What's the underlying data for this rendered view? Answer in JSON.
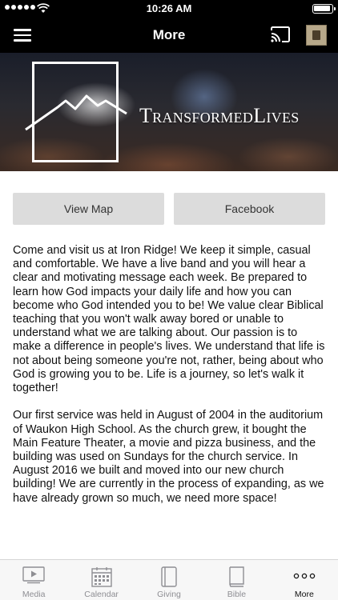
{
  "status_bar": {
    "time": "10:26 AM"
  },
  "nav": {
    "title": "More"
  },
  "hero": {
    "brand_text": "TransformedLives"
  },
  "buttons": {
    "view_map": "View Map",
    "facebook": "Facebook"
  },
  "description": {
    "paragraphs": [
      "Come and visit us at Iron Ridge! We keep it simple, casual and comfortable. We have a live band and you will hear a clear and motivating message each week. Be prepared to learn how God impacts your daily life and how you can become who God intended you to be! We value clear Biblical teaching that you won't walk away bored or unable to understand what we are talking about. Our passion is to make a difference in people's lives. We understand that life is not about being someone you're not, rather, being about who God is growing you to be. Life is a journey, so let's walk it together!",
      "Our first service was held in August of 2004 in the auditorium of Waukon High School. As the church grew, it bought the Main Feature Theater, a movie and pizza business, and the building was used on Sundays for the church service. In August 2016 we built and moved into our new church building! We are currently in the process of expanding, as we have already grown so much, we need more space!"
    ]
  },
  "tabs": [
    {
      "label": "Media",
      "icon": "media-icon",
      "active": false
    },
    {
      "label": "Calendar",
      "icon": "calendar-icon",
      "active": false
    },
    {
      "label": "Giving",
      "icon": "giving-icon",
      "active": false
    },
    {
      "label": "Bible",
      "icon": "bible-icon",
      "active": false
    },
    {
      "label": "More",
      "icon": "more-icon",
      "active": true
    }
  ],
  "colors": {
    "nav_background": "#000000",
    "button_background": "#dcdcdc",
    "tab_inactive": "#8e8e93",
    "tab_active": "#111111"
  }
}
